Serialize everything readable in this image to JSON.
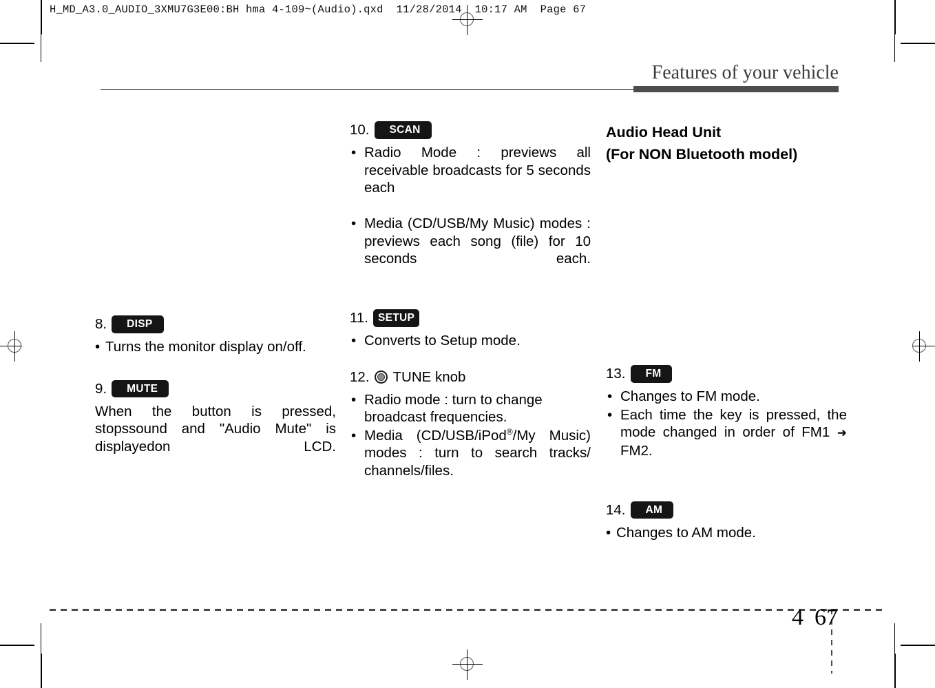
{
  "prepress": {
    "slug": "H_MD_A3.0_AUDIO_3XMU7G3E00:BH hma 4-109~(Audio).qxd  11/28/2014  10:17 AM  Page 67",
    "registration_icon": "registration-target-icon"
  },
  "header": {
    "title": "Features of your vehicle"
  },
  "columns": {
    "left": [
      {
        "number": "8.",
        "badge": "DISP",
        "badge_style": "wide",
        "lines": [
          {
            "kind": "bullet-tight",
            "text": "Turns the monitor display on/off."
          }
        ]
      },
      {
        "number": "9.",
        "badge": "MUTE",
        "badge_style": "wide",
        "lines": [
          {
            "kind": "para-justify",
            "text": "When the button is pressed, stopssound and \"Audio Mute\" is displayedon LCD."
          }
        ]
      }
    ],
    "middle": [
      {
        "number": "10.",
        "badge": "SCAN",
        "badge_style": "wide",
        "lines": [
          {
            "kind": "bullet-justify",
            "text": "Radio Mode : previews all receivable broadcasts for 5 seconds each"
          },
          {
            "kind": "bullet-justify",
            "text": "Media (CD/USB/My Music) modes : previews each song (file) for 10 seconds each."
          }
        ]
      },
      {
        "number": "11.",
        "badge": "SETUP",
        "badge_style": "snug",
        "lines": [
          {
            "kind": "bullet",
            "text": "Converts to Setup mode."
          }
        ]
      },
      {
        "number": "12.",
        "knob_icon": "tune-knob-icon",
        "knob_label": "TUNE knob",
        "lines": [
          {
            "kind": "bullet",
            "text": "Radio mode : turn to change broadcast frequencies."
          },
          {
            "kind": "bullet-justify-ipod",
            "text_before": "Media (CD/USB/iPod",
            "superscript": "®",
            "text_after": "/My Music) modes : turn to search tracks/ channels/files."
          }
        ]
      }
    ],
    "right": {
      "section_heading": [
        "Audio Head Unit",
        "(For NON Bluetooth model)"
      ],
      "items": [
        {
          "number": "13.",
          "badge": "FM",
          "badge_style": "wide",
          "lines": [
            {
              "kind": "bullet",
              "text": "Changes to FM mode."
            },
            {
              "kind": "bullet-justify-arrow",
              "text_before": "Each time the key is pressed, the mode changed in order of FM1",
              "arrow": "➜",
              "text_after": "FM2."
            }
          ]
        },
        {
          "number": "14.",
          "badge": "AM",
          "badge_style": "wide",
          "lines": [
            {
              "kind": "bullet-tight",
              "text": "Changes to AM mode."
            }
          ]
        }
      ]
    }
  },
  "footer": {
    "chapter": "4",
    "page_number": "67"
  },
  "colors": {
    "badge_bg": "#151515",
    "badge_text": "#ffffff",
    "header_title": "#3b3b3b",
    "header_rule": "#4d4d4d",
    "footer_rule": "#4a4a4a"
  }
}
